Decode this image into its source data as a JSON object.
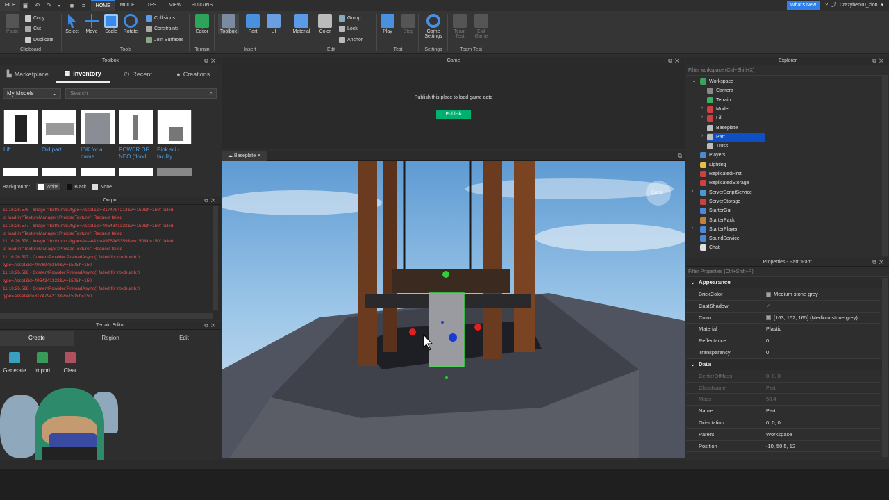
{
  "menubar": {
    "file": "FILE",
    "tabs": [
      "HOME",
      "MODEL",
      "TEST",
      "VIEW",
      "PLUGINS"
    ],
    "active_tab": "HOME",
    "whats_new": "What's New",
    "username": "Crazyben10_zion"
  },
  "ribbon": {
    "clipboard": {
      "paste": "Paste",
      "copy": "Copy",
      "cut": "Cut",
      "duplicate": "Duplicate",
      "label": "Clipboard"
    },
    "tools": {
      "select": "Select",
      "move": "Move",
      "scale": "Scale",
      "rotate": "Rotate",
      "collisions": "Collisions",
      "constraints": "Constraints",
      "join_surfaces": "Join Surfaces",
      "label": "Tools"
    },
    "terrain": {
      "editor": "Editor",
      "label": "Terrain"
    },
    "insert": {
      "toolbox": "Toolbox",
      "part": "Part",
      "ui": "UI",
      "label": "Insert"
    },
    "edit": {
      "material": "Material",
      "color": "Color",
      "group": "Group",
      "lock": "Lock",
      "anchor": "Anchor",
      "label": "Edit"
    },
    "test": {
      "play": "Play",
      "stop": "Stop",
      "label": "Test"
    },
    "settings": {
      "game_settings_1": "Game",
      "game_settings_2": "Settings",
      "label": "Settings"
    },
    "team_test": {
      "team_test_1": "Team",
      "team_test_2": "Test",
      "exit_game_1": "Exit",
      "exit_game_2": "Game",
      "label": "Team Test"
    }
  },
  "toolbox": {
    "title": "Toolbox",
    "tabs": [
      "Marketplace",
      "Inventory",
      "Recent",
      "Creations"
    ],
    "active_tab": "Inventory",
    "filter": "My Models",
    "search_placeholder": "Search",
    "models": [
      {
        "name_1": "Lift",
        "name_2": ""
      },
      {
        "name_1": "Old part",
        "name_2": ""
      },
      {
        "name_1": "IDK for a",
        "name_2": "name"
      },
      {
        "name_1": "POWER OF",
        "name_2": "NEO (flood"
      },
      {
        "name_1": "Pink sci -",
        "name_2": "facility"
      }
    ],
    "background_label": "Background:",
    "background_options": [
      "White",
      "Black",
      "None"
    ]
  },
  "output": {
    "title": "Output",
    "lines": [
      "11:16:26.576 - Image \"rbxthumb://type=Asset&id=3174794213&w=150&h=150\" failed",
      "to load in \"TextureManager::PreloadTexture\": Request failed",
      "11:16:26.577 - Image \"rbxthumb://type=Asset&id=4954341332&w=150&h=150\" failed",
      "to load in \"TextureManager::PreloadTexture\": Request failed",
      "11:16:26.578 - Image \"rbxthumb://type=Asset&id=4976945359&w=150&h=150\" failed",
      "to load in \"TextureManager::PreloadTexture\": Request failed",
      "11:16:26.597 - ContentProvider:PreloadAsync() failed for rbxthumb://",
      "type=Asset&id=4976945359&w=150&h=150",
      "11:16:26.598 - ContentProvider:PreloadAsync() failed for rbxthumb://",
      "type=Asset&id=4954341332&w=150&h=150",
      "11:16:26.598 - ContentProvider:PreloadAsync() failed for rbxthumb://",
      "type=Asset&id=3174794213&w=150&h=150"
    ]
  },
  "terrain_editor": {
    "title": "Terrain Editor",
    "tabs": [
      "Create",
      "Region",
      "Edit"
    ],
    "active_tab": "Create",
    "buttons": [
      "Generate",
      "Import",
      "Clear"
    ]
  },
  "game": {
    "title": "Game",
    "message": "Publish this place to load game data",
    "publish": "Publish"
  },
  "viewport": {
    "tab": "Baseplate",
    "back_label": "Back"
  },
  "explorer": {
    "title": "Explorer",
    "filter_placeholder": "Filter workspace (Ctrl+Shift+X)",
    "items": [
      {
        "label": "Workspace",
        "icon": "workspace-icon",
        "color": "#3aa35a"
      },
      {
        "label": "Camera",
        "icon": "camera-icon",
        "color": "#8a8a8a"
      },
      {
        "label": "Terrain",
        "icon": "terrain-icon",
        "color": "#3ab060"
      },
      {
        "label": "Model",
        "icon": "model-icon",
        "color": "#d04040"
      },
      {
        "label": "Lift",
        "icon": "model-icon",
        "color": "#d04040"
      },
      {
        "label": "Baseplate",
        "icon": "part-icon",
        "color": "#bdbdbd"
      },
      {
        "label": "Part",
        "icon": "part-icon",
        "color": "#bdbdbd"
      },
      {
        "label": "Truss",
        "icon": "truss-icon",
        "color": "#bdbdbd"
      },
      {
        "label": "Players",
        "icon": "players-icon",
        "color": "#4a88d8"
      },
      {
        "label": "Lighting",
        "icon": "lighting-icon",
        "color": "#e8c040"
      },
      {
        "label": "ReplicatedFirst",
        "icon": "replicated-icon",
        "color": "#d04040"
      },
      {
        "label": "ReplicatedStorage",
        "icon": "replicated-icon",
        "color": "#d04040"
      },
      {
        "label": "ServerScriptService",
        "icon": "server-script-icon",
        "color": "#4a9ad8"
      },
      {
        "label": "ServerStorage",
        "icon": "server-storage-icon",
        "color": "#d04040"
      },
      {
        "label": "StarterGui",
        "icon": "starter-gui-icon",
        "color": "#4a88d8"
      },
      {
        "label": "StarterPack",
        "icon": "starter-pack-icon",
        "color": "#c08040"
      },
      {
        "label": "StarterPlayer",
        "icon": "starter-player-icon",
        "color": "#4a88d8"
      },
      {
        "label": "SoundService",
        "icon": "sound-icon",
        "color": "#4a88d8"
      },
      {
        "label": "Chat",
        "icon": "chat-icon",
        "color": "#e0e0e0"
      }
    ],
    "selected": "Part"
  },
  "properties": {
    "title": "Properties - Part \"Part\"",
    "filter_placeholder": "Filter Properties (Ctrl+Shift+P)",
    "sections": {
      "appearance": "Appearance",
      "data": "Data"
    },
    "appearance_rows": [
      {
        "name": "BrickColor",
        "value": "Medium stone grey",
        "swatch": true
      },
      {
        "name": "CastShadow",
        "value": "✓",
        "swatch": false
      },
      {
        "name": "Color",
        "value": "[163, 162, 165] (Medium stone grey)",
        "swatch": true
      },
      {
        "name": "Material",
        "value": "Plastic",
        "swatch": false
      },
      {
        "name": "Reflectance",
        "value": "0",
        "swatch": false
      },
      {
        "name": "Transparency",
        "value": "0",
        "swatch": false
      }
    ],
    "data_rows": [
      {
        "name": "CenterOfMass",
        "value": "0, 0, 0",
        "dim": true
      },
      {
        "name": "ClassName",
        "value": "Part",
        "dim": true
      },
      {
        "name": "Mass",
        "value": "50.4",
        "dim": true
      },
      {
        "name": "Name",
        "value": "Part",
        "dim": false
      },
      {
        "name": "Orientation",
        "value": "0, 0, 0",
        "dim": false
      },
      {
        "name": "Parent",
        "value": "Workspace",
        "dim": false
      },
      {
        "name": "Position",
        "value": "-10, 50.5, 12",
        "dim": false
      }
    ],
    "swatch_color": "#a3a2a5"
  }
}
